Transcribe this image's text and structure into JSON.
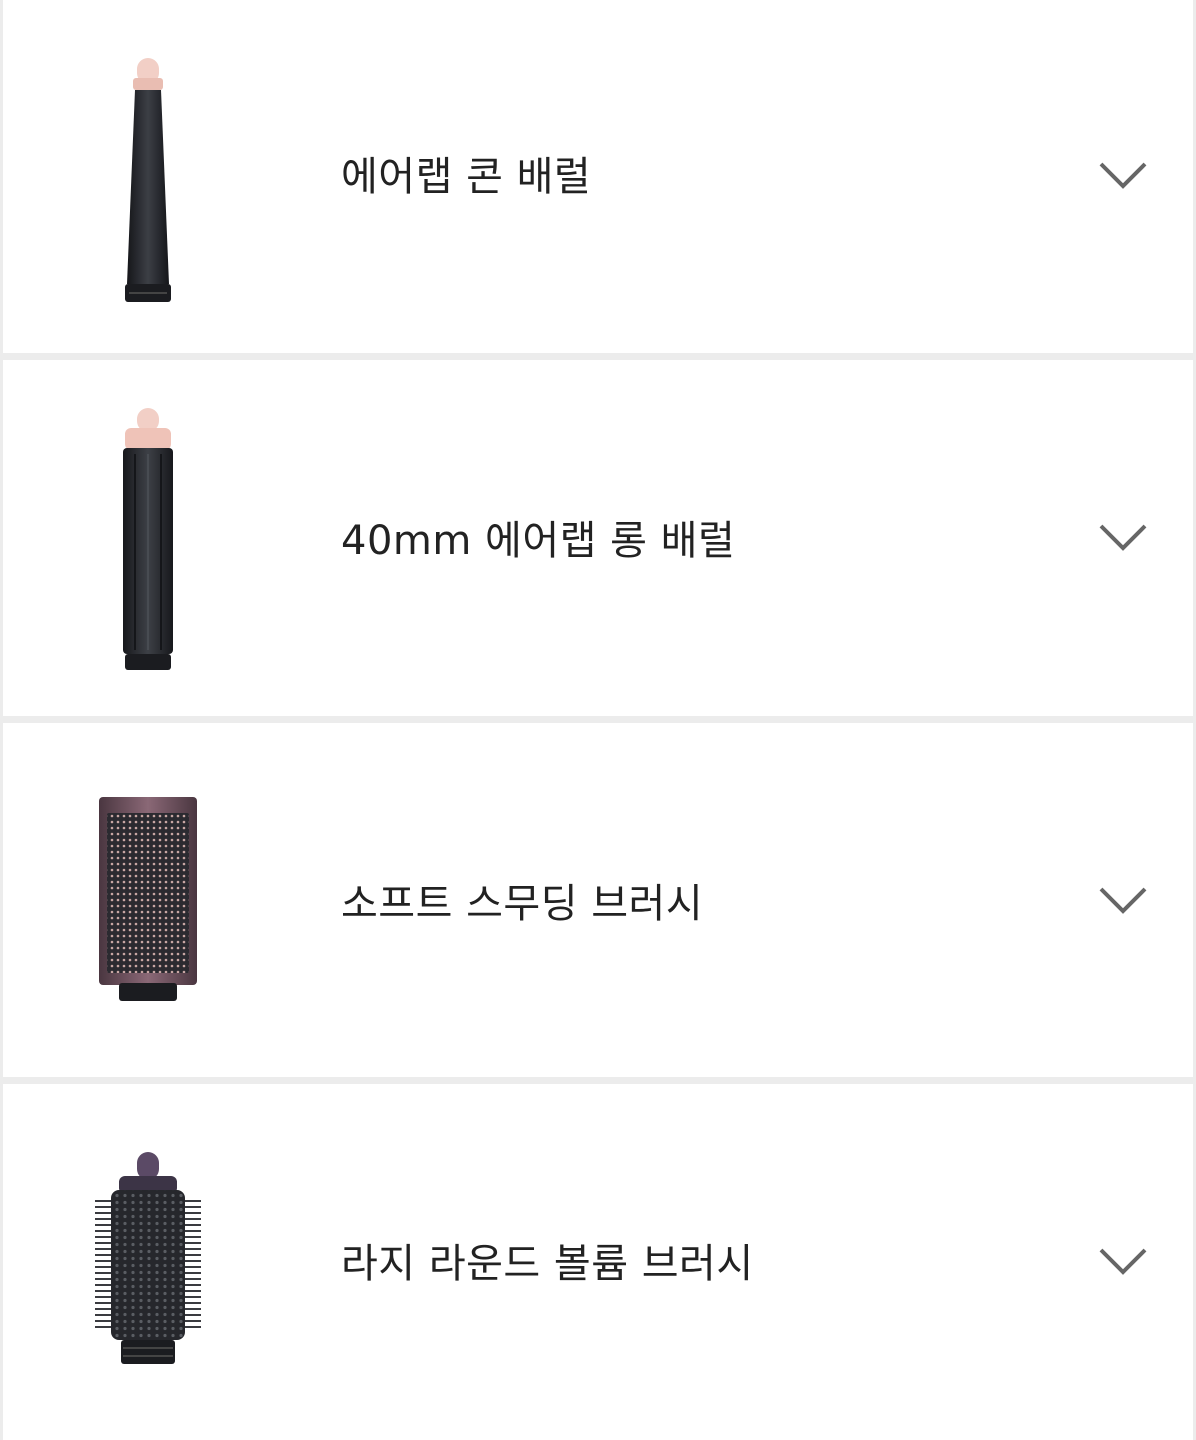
{
  "accessories": [
    {
      "name": "에어랩 콘 배럴",
      "thumbnail_icon": "cone-barrel-icon",
      "expand_icon": "chevron-down-icon"
    },
    {
      "name": "40mm 에어랩 롱 배럴",
      "thumbnail_icon": "long-barrel-icon",
      "expand_icon": "chevron-down-icon"
    },
    {
      "name": "소프트 스무딩 브러시",
      "thumbnail_icon": "soft-smoothing-brush-icon",
      "expand_icon": "chevron-down-icon"
    },
    {
      "name": "라지 라운드 볼륨 브러시",
      "thumbnail_icon": "large-round-volume-brush-icon",
      "expand_icon": "chevron-down-icon"
    }
  ],
  "colors": {
    "barrel_dark": "#2b2d31",
    "tip_pink": "#f0c9bf",
    "brush_mauve": "#6e4f5c",
    "text": "#222222",
    "chevron": "#666666",
    "divider": "#ececec"
  }
}
